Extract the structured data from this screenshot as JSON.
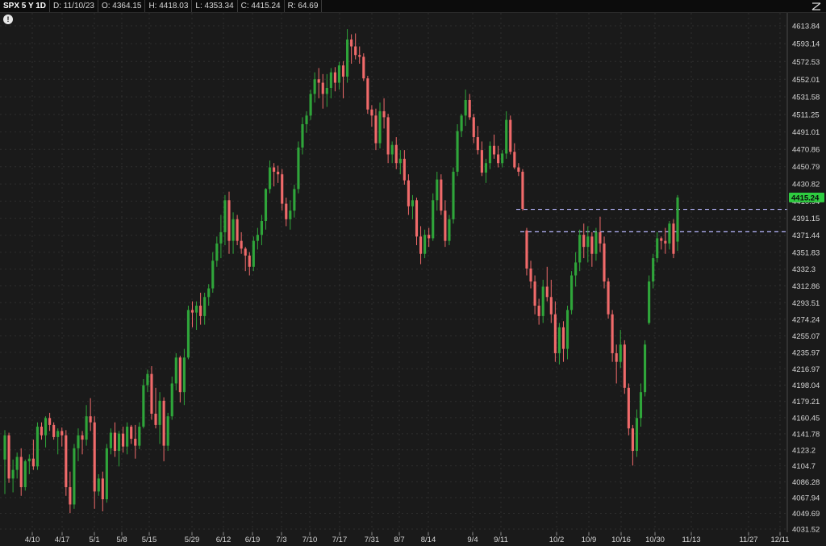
{
  "header": {
    "symbol": "SPX 5 Y 1D",
    "date": "D: 11/10/23",
    "open": "O: 4364.15",
    "high": "H: 4418.03",
    "low": "L: 4353.34",
    "close": "C: 4415.24",
    "range": "R: 64.69"
  },
  "alert_icon": "!",
  "colors": {
    "up": "#2fa53a",
    "down": "#f06a6a",
    "background": "#1a1a1a",
    "grid": "#2e2e2e",
    "last_price_tag": "#2ecc40",
    "reference_line": "#b8b8ff"
  },
  "chart_data": {
    "type": "candlestick",
    "title": "",
    "xlabel": "",
    "ylabel": "",
    "ylim": [
      4022,
      4624
    ],
    "grid": true,
    "y_ticks": [
      "4613.84",
      "4593.14",
      "4572.53",
      "4552.01",
      "4531.58",
      "4511.25",
      "4491.01",
      "4470.86",
      "4450.79",
      "4430.82",
      "4410.94",
      "4391.15",
      "4371.44",
      "4351.83",
      "4332.3",
      "4312.86",
      "4293.51",
      "4274.24",
      "4255.07",
      "4235.97",
      "4216.97",
      "4198.04",
      "4179.21",
      "4160.45",
      "4141.78",
      "4123.2",
      "4104.7",
      "4086.28",
      "4067.94",
      "4049.69",
      "4031.52"
    ],
    "x_tick_labels": [
      "4/10",
      "4/17",
      "5/1",
      "5/8",
      "5/15",
      "5/29",
      "6/12",
      "6/19",
      "7/3",
      "7/10",
      "7/17",
      "7/31",
      "8/7",
      "8/14",
      "9/4",
      "9/11",
      "10/2",
      "10/9",
      "10/16",
      "10/30",
      "11/13",
      "11/27",
      "12/11"
    ],
    "last_price": "4415.24",
    "reference_levels": [
      4401.5,
      4375.5
    ],
    "candles": [
      {
        "o": 4112,
        "h": 4146,
        "l": 4072,
        "c": 4140
      },
      {
        "o": 4140,
        "h": 4143,
        "l": 4085,
        "c": 4090
      },
      {
        "o": 4090,
        "h": 4112,
        "l": 4074,
        "c": 4100
      },
      {
        "o": 4100,
        "h": 4120,
        "l": 4090,
        "c": 4115
      },
      {
        "o": 4115,
        "h": 4125,
        "l": 4070,
        "c": 4080
      },
      {
        "o": 4080,
        "h": 4112,
        "l": 4076,
        "c": 4110
      },
      {
        "o": 4110,
        "h": 4118,
        "l": 4095,
        "c": 4113
      },
      {
        "o": 4113,
        "h": 4135,
        "l": 4100,
        "c": 4104
      },
      {
        "o": 4104,
        "h": 4155,
        "l": 4100,
        "c": 4150
      },
      {
        "o": 4150,
        "h": 4155,
        "l": 4135,
        "c": 4140
      },
      {
        "o": 4140,
        "h": 4162,
        "l": 4126,
        "c": 4160
      },
      {
        "o": 4160,
        "h": 4166,
        "l": 4145,
        "c": 4152
      },
      {
        "o": 4152,
        "h": 4155,
        "l": 4135,
        "c": 4138
      },
      {
        "o": 4138,
        "h": 4148,
        "l": 4118,
        "c": 4145
      },
      {
        "o": 4145,
        "h": 4149,
        "l": 4127,
        "c": 4140
      },
      {
        "o": 4140,
        "h": 4146,
        "l": 4070,
        "c": 4080
      },
      {
        "o": 4080,
        "h": 4098,
        "l": 4050,
        "c": 4060
      },
      {
        "o": 4060,
        "h": 4130,
        "l": 4055,
        "c": 4125
      },
      {
        "o": 4125,
        "h": 4148,
        "l": 4110,
        "c": 4140
      },
      {
        "o": 4140,
        "h": 4145,
        "l": 4118,
        "c": 4135
      },
      {
        "o": 4135,
        "h": 4175,
        "l": 4128,
        "c": 4162
      },
      {
        "o": 4162,
        "h": 4183,
        "l": 4145,
        "c": 4155
      },
      {
        "o": 4155,
        "h": 4162,
        "l": 4055,
        "c": 4075
      },
      {
        "o": 4075,
        "h": 4095,
        "l": 4070,
        "c": 4090
      },
      {
        "o": 4090,
        "h": 4098,
        "l": 4052,
        "c": 4066
      },
      {
        "o": 4066,
        "h": 4130,
        "l": 4062,
        "c": 4125
      },
      {
        "o": 4125,
        "h": 4148,
        "l": 4118,
        "c": 4143
      },
      {
        "o": 4143,
        "h": 4155,
        "l": 4115,
        "c": 4122
      },
      {
        "o": 4122,
        "h": 4145,
        "l": 4104,
        "c": 4142
      },
      {
        "o": 4142,
        "h": 4150,
        "l": 4120,
        "c": 4127
      },
      {
        "o": 4127,
        "h": 4155,
        "l": 4118,
        "c": 4150
      },
      {
        "o": 4150,
        "h": 4152,
        "l": 4130,
        "c": 4136
      },
      {
        "o": 4136,
        "h": 4152,
        "l": 4113,
        "c": 4128
      },
      {
        "o": 4128,
        "h": 4155,
        "l": 4124,
        "c": 4150
      },
      {
        "o": 4150,
        "h": 4205,
        "l": 4148,
        "c": 4198
      },
      {
        "o": 4198,
        "h": 4216,
        "l": 4190,
        "c": 4211
      },
      {
        "o": 4211,
        "h": 4220,
        "l": 4158,
        "c": 4165
      },
      {
        "o": 4165,
        "h": 4195,
        "l": 4148,
        "c": 4152
      },
      {
        "o": 4152,
        "h": 4190,
        "l": 4130,
        "c": 4180
      },
      {
        "o": 4180,
        "h": 4184,
        "l": 4110,
        "c": 4128
      },
      {
        "o": 4128,
        "h": 4166,
        "l": 4122,
        "c": 4162
      },
      {
        "o": 4162,
        "h": 4208,
        "l": 4158,
        "c": 4200
      },
      {
        "o": 4200,
        "h": 4235,
        "l": 4192,
        "c": 4230
      },
      {
        "o": 4230,
        "h": 4232,
        "l": 4178,
        "c": 4190
      },
      {
        "o": 4190,
        "h": 4240,
        "l": 4175,
        "c": 4230
      },
      {
        "o": 4230,
        "h": 4290,
        "l": 4228,
        "c": 4285
      },
      {
        "o": 4285,
        "h": 4295,
        "l": 4265,
        "c": 4282
      },
      {
        "o": 4282,
        "h": 4295,
        "l": 4262,
        "c": 4290
      },
      {
        "o": 4290,
        "h": 4305,
        "l": 4268,
        "c": 4278
      },
      {
        "o": 4278,
        "h": 4305,
        "l": 4268,
        "c": 4300
      },
      {
        "o": 4300,
        "h": 4315,
        "l": 4290,
        "c": 4310
      },
      {
        "o": 4310,
        "h": 4352,
        "l": 4305,
        "c": 4342
      },
      {
        "o": 4342,
        "h": 4370,
        "l": 4335,
        "c": 4362
      },
      {
        "o": 4362,
        "h": 4395,
        "l": 4345,
        "c": 4375
      },
      {
        "o": 4375,
        "h": 4418,
        "l": 4360,
        "c": 4412
      },
      {
        "o": 4412,
        "h": 4422,
        "l": 4350,
        "c": 4365
      },
      {
        "o": 4365,
        "h": 4398,
        "l": 4350,
        "c": 4390
      },
      {
        "o": 4390,
        "h": 4395,
        "l": 4360,
        "c": 4365
      },
      {
        "o": 4365,
        "h": 4375,
        "l": 4350,
        "c": 4356
      },
      {
        "o": 4356,
        "h": 4358,
        "l": 4330,
        "c": 4348
      },
      {
        "o": 4348,
        "h": 4352,
        "l": 4325,
        "c": 4335
      },
      {
        "o": 4335,
        "h": 4370,
        "l": 4330,
        "c": 4365
      },
      {
        "o": 4365,
        "h": 4380,
        "l": 4355,
        "c": 4372
      },
      {
        "o": 4372,
        "h": 4395,
        "l": 4360,
        "c": 4388
      },
      {
        "o": 4388,
        "h": 4426,
        "l": 4378,
        "c": 4425
      },
      {
        "o": 4425,
        "h": 4458,
        "l": 4420,
        "c": 4450
      },
      {
        "o": 4450,
        "h": 4455,
        "l": 4428,
        "c": 4445
      },
      {
        "o": 4445,
        "h": 4452,
        "l": 4432,
        "c": 4442
      },
      {
        "o": 4442,
        "h": 4448,
        "l": 4400,
        "c": 4408
      },
      {
        "o": 4408,
        "h": 4415,
        "l": 4382,
        "c": 4390
      },
      {
        "o": 4390,
        "h": 4412,
        "l": 4378,
        "c": 4400
      },
      {
        "o": 4400,
        "h": 4430,
        "l": 4392,
        "c": 4425
      },
      {
        "o": 4425,
        "h": 4480,
        "l": 4420,
        "c": 4473
      },
      {
        "o": 4473,
        "h": 4508,
        "l": 4465,
        "c": 4500
      },
      {
        "o": 4500,
        "h": 4515,
        "l": 4490,
        "c": 4510
      },
      {
        "o": 4510,
        "h": 4540,
        "l": 4505,
        "c": 4535
      },
      {
        "o": 4535,
        "h": 4560,
        "l": 4525,
        "c": 4552
      },
      {
        "o": 4552,
        "h": 4565,
        "l": 4530,
        "c": 4548
      },
      {
        "o": 4548,
        "h": 4558,
        "l": 4518,
        "c": 4535
      },
      {
        "o": 4535,
        "h": 4558,
        "l": 4520,
        "c": 4542
      },
      {
        "o": 4542,
        "h": 4565,
        "l": 4530,
        "c": 4560
      },
      {
        "o": 4560,
        "h": 4566,
        "l": 4538,
        "c": 4548
      },
      {
        "o": 4548,
        "h": 4572,
        "l": 4540,
        "c": 4568
      },
      {
        "o": 4568,
        "h": 4573,
        "l": 4530,
        "c": 4555
      },
      {
        "o": 4555,
        "h": 4610,
        "l": 4548,
        "c": 4598
      },
      {
        "o": 4598,
        "h": 4604,
        "l": 4570,
        "c": 4590
      },
      {
        "o": 4590,
        "h": 4605,
        "l": 4575,
        "c": 4580
      },
      {
        "o": 4580,
        "h": 4590,
        "l": 4570,
        "c": 4578
      },
      {
        "o": 4578,
        "h": 4582,
        "l": 4550,
        "c": 4553
      },
      {
        "o": 4553,
        "h": 4556,
        "l": 4512,
        "c": 4517
      },
      {
        "o": 4517,
        "h": 4522,
        "l": 4497,
        "c": 4510
      },
      {
        "o": 4510,
        "h": 4518,
        "l": 4470,
        "c": 4478
      },
      {
        "o": 4478,
        "h": 4525,
        "l": 4472,
        "c": 4515
      },
      {
        "o": 4515,
        "h": 4530,
        "l": 4495,
        "c": 4508
      },
      {
        "o": 4508,
        "h": 4512,
        "l": 4455,
        "c": 4465
      },
      {
        "o": 4465,
        "h": 4480,
        "l": 4455,
        "c": 4476
      },
      {
        "o": 4476,
        "h": 4485,
        "l": 4448,
        "c": 4455
      },
      {
        "o": 4455,
        "h": 4470,
        "l": 4442,
        "c": 4460
      },
      {
        "o": 4460,
        "h": 4470,
        "l": 4430,
        "c": 4435
      },
      {
        "o": 4435,
        "h": 4442,
        "l": 4395,
        "c": 4405
      },
      {
        "o": 4405,
        "h": 4418,
        "l": 4390,
        "c": 4412
      },
      {
        "o": 4412,
        "h": 4415,
        "l": 4360,
        "c": 4370
      },
      {
        "o": 4370,
        "h": 4382,
        "l": 4338,
        "c": 4350
      },
      {
        "o": 4350,
        "h": 4378,
        "l": 4345,
        "c": 4372
      },
      {
        "o": 4372,
        "h": 4380,
        "l": 4358,
        "c": 4368
      },
      {
        "o": 4368,
        "h": 4420,
        "l": 4365,
        "c": 4412
      },
      {
        "o": 4412,
        "h": 4445,
        "l": 4400,
        "c": 4436
      },
      {
        "o": 4436,
        "h": 4442,
        "l": 4395,
        "c": 4400
      },
      {
        "o": 4400,
        "h": 4412,
        "l": 4358,
        "c": 4365
      },
      {
        "o": 4365,
        "h": 4395,
        "l": 4360,
        "c": 4390
      },
      {
        "o": 4390,
        "h": 4450,
        "l": 4385,
        "c": 4445
      },
      {
        "o": 4445,
        "h": 4500,
        "l": 4440,
        "c": 4492
      },
      {
        "o": 4492,
        "h": 4512,
        "l": 4485,
        "c": 4510
      },
      {
        "o": 4510,
        "h": 4540,
        "l": 4498,
        "c": 4528
      },
      {
        "o": 4528,
        "h": 4535,
        "l": 4505,
        "c": 4508
      },
      {
        "o": 4508,
        "h": 4512,
        "l": 4478,
        "c": 4485
      },
      {
        "o": 4485,
        "h": 4498,
        "l": 4465,
        "c": 4470
      },
      {
        "o": 4470,
        "h": 4480,
        "l": 4440,
        "c": 4444
      },
      {
        "o": 4444,
        "h": 4460,
        "l": 4432,
        "c": 4455
      },
      {
        "o": 4455,
        "h": 4480,
        "l": 4448,
        "c": 4475
      },
      {
        "o": 4475,
        "h": 4488,
        "l": 4460,
        "c": 4465
      },
      {
        "o": 4465,
        "h": 4475,
        "l": 4450,
        "c": 4455
      },
      {
        "o": 4455,
        "h": 4470,
        "l": 4450,
        "c": 4466
      },
      {
        "o": 4466,
        "h": 4515,
        "l": 4460,
        "c": 4505
      },
      {
        "o": 4505,
        "h": 4510,
        "l": 4465,
        "c": 4468
      },
      {
        "o": 4468,
        "h": 4478,
        "l": 4448,
        "c": 4450
      },
      {
        "o": 4450,
        "h": 4455,
        "l": 4440,
        "c": 4445
      },
      {
        "o": 4445,
        "h": 4448,
        "l": 4400,
        "c": 4402
      },
      {
        "o": 4377,
        "h": 4380,
        "l": 4325,
        "c": 4333
      },
      {
        "o": 4333,
        "h": 4342,
        "l": 4310,
        "c": 4318
      },
      {
        "o": 4318,
        "h": 4325,
        "l": 4280,
        "c": 4290
      },
      {
        "o": 4290,
        "h": 4298,
        "l": 4268,
        "c": 4278
      },
      {
        "o": 4278,
        "h": 4320,
        "l": 4270,
        "c": 4312
      },
      {
        "o": 4312,
        "h": 4335,
        "l": 4295,
        "c": 4300
      },
      {
        "o": 4300,
        "h": 4320,
        "l": 4270,
        "c": 4280
      },
      {
        "o": 4280,
        "h": 4295,
        "l": 4225,
        "c": 4235
      },
      {
        "o": 4235,
        "h": 4270,
        "l": 4222,
        "c": 4265
      },
      {
        "o": 4265,
        "h": 4272,
        "l": 4225,
        "c": 4240
      },
      {
        "o": 4240,
        "h": 4290,
        "l": 4228,
        "c": 4285
      },
      {
        "o": 4285,
        "h": 4330,
        "l": 4280,
        "c": 4325
      },
      {
        "o": 4325,
        "h": 4352,
        "l": 4312,
        "c": 4340
      },
      {
        "o": 4340,
        "h": 4378,
        "l": 4330,
        "c": 4372
      },
      {
        "o": 4372,
        "h": 4385,
        "l": 4345,
        "c": 4358
      },
      {
        "o": 4358,
        "h": 4382,
        "l": 4340,
        "c": 4370
      },
      {
        "o": 4370,
        "h": 4375,
        "l": 4335,
        "c": 4350
      },
      {
        "o": 4350,
        "h": 4380,
        "l": 4342,
        "c": 4375
      },
      {
        "o": 4375,
        "h": 4393,
        "l": 4352,
        "c": 4362
      },
      {
        "o": 4362,
        "h": 4370,
        "l": 4310,
        "c": 4318
      },
      {
        "o": 4318,
        "h": 4322,
        "l": 4275,
        "c": 4280
      },
      {
        "o": 4280,
        "h": 4285,
        "l": 4225,
        "c": 4235
      },
      {
        "o": 4235,
        "h": 4245,
        "l": 4200,
        "c": 4225
      },
      {
        "o": 4225,
        "h": 4262,
        "l": 4218,
        "c": 4245
      },
      {
        "o": 4245,
        "h": 4250,
        "l": 4188,
        "c": 4195
      },
      {
        "o": 4195,
        "h": 4200,
        "l": 4140,
        "c": 4148
      },
      {
        "o": 4148,
        "h": 4152,
        "l": 4105,
        "c": 4122
      },
      {
        "o": 4122,
        "h": 4170,
        "l": 4115,
        "c": 4160
      },
      {
        "o": 4160,
        "h": 4200,
        "l": 4150,
        "c": 4190
      },
      {
        "o": 4190,
        "h": 4250,
        "l": 4185,
        "c": 4245
      },
      {
        "o": 4270,
        "h": 4325,
        "l": 4268,
        "c": 4318
      },
      {
        "o": 4318,
        "h": 4350,
        "l": 4310,
        "c": 4345
      },
      {
        "o": 4345,
        "h": 4375,
        "l": 4340,
        "c": 4368
      },
      {
        "o": 4368,
        "h": 4370,
        "l": 4355,
        "c": 4365
      },
      {
        "o": 4365,
        "h": 4380,
        "l": 4350,
        "c": 4362
      },
      {
        "o": 4362,
        "h": 4388,
        "l": 4355,
        "c": 4385
      },
      {
        "o": 4385,
        "h": 4390,
        "l": 4345,
        "c": 4350
      },
      {
        "o": 4364.15,
        "h": 4418.03,
        "l": 4353.34,
        "c": 4415.24
      }
    ]
  }
}
